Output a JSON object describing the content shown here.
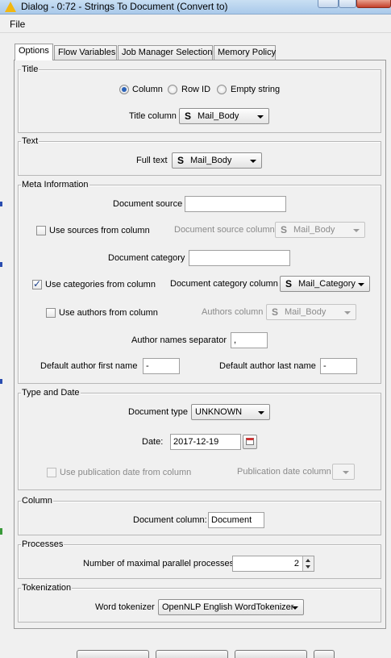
{
  "window": {
    "title": "Dialog - 0:72 - Strings To Document (Convert to)"
  },
  "menu": {
    "file": "File"
  },
  "tabs": [
    "Options",
    "Flow Variables",
    "Job Manager Selection",
    "Memory Policy"
  ],
  "title_group": {
    "legend": "Title",
    "radio_column": "Column",
    "radio_rowid": "Row ID",
    "radio_empty": "Empty string",
    "title_column_label": "Title column",
    "title_column_value": "Mail_Body"
  },
  "text_group": {
    "legend": "Text",
    "full_text_label": "Full text",
    "full_text_value": "Mail_Body"
  },
  "meta_group": {
    "legend": "Meta Information",
    "doc_source_label": "Document source",
    "doc_source_value": "",
    "use_sources_label": "Use sources from column",
    "doc_source_column_label": "Document source column",
    "doc_source_column_value": "Mail_Body",
    "doc_category_label": "Document category",
    "doc_category_value": "",
    "use_categories_label": "Use categories from column",
    "doc_category_column_label": "Document category column",
    "doc_category_column_value": "Mail_Category",
    "use_authors_label": "Use authors from column",
    "authors_column_label": "Authors column",
    "authors_column_value": "Mail_Body",
    "author_sep_label": "Author names separator",
    "author_sep_value": ",",
    "default_first_label": "Default author first name",
    "default_first_value": "-",
    "default_last_label": "Default author last name",
    "default_last_value": "-"
  },
  "type_group": {
    "legend": "Type and Date",
    "doc_type_label": "Document type",
    "doc_type_value": "UNKNOWN",
    "date_label": "Date:",
    "date_value": "2017-12-19",
    "use_pubdate_label": "Use publication date from column",
    "pubdate_column_label": "Publication date column",
    "pubdate_column_value": ""
  },
  "column_group": {
    "legend": "Column",
    "doc_column_label": "Document column:",
    "doc_column_value": "Document"
  },
  "processes_group": {
    "legend": "Processes",
    "max_proc_label": "Number of maximal parallel processes",
    "max_proc_value": "2"
  },
  "tokenization_group": {
    "legend": "Tokenization",
    "tokenizer_label": "Word tokenizer",
    "tokenizer_value": "OpenNLP English WordTokenizer"
  },
  "checkbox_states": {
    "use_sources": false,
    "use_categories": true,
    "use_authors": false,
    "use_pubdate": false
  },
  "colors": {
    "accent": "#2a62b8",
    "warning_icon": "#f2b711"
  }
}
